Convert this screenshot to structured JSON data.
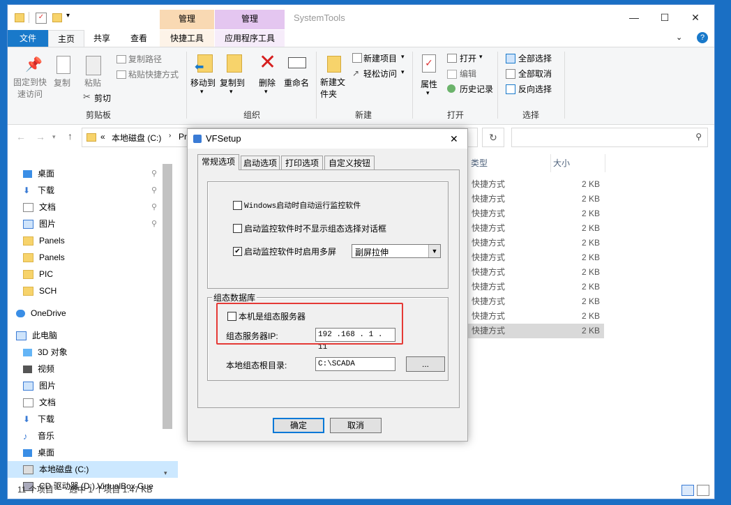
{
  "window": {
    "title": "SystemTools",
    "ctx_tabs": [
      "管理",
      "管理"
    ],
    "controls": [
      "—",
      "☐",
      "✕"
    ]
  },
  "tabs": [
    "文件",
    "主页",
    "共享",
    "查看",
    "快捷工具",
    "应用程序工具"
  ],
  "ribbon": {
    "clipboard": {
      "pin": "固定到快速访问",
      "copy": "复制",
      "paste": "粘贴",
      "copy_path": "复制路径",
      "paste_shortcut": "粘贴快捷方式",
      "cut": "剪切",
      "group": "剪贴板"
    },
    "organize": {
      "move_to": "移动到",
      "copy_to": "复制到",
      "delete": "删除",
      "rename": "重命名",
      "group": "组织"
    },
    "new": {
      "new_folder": "新建文件夹",
      "new_item": "新建项目",
      "easy_access": "轻松访问",
      "group": "新建"
    },
    "open": {
      "properties": "属性",
      "open": "打开",
      "edit": "编辑",
      "history": "历史记录",
      "group": "打开"
    },
    "select": {
      "select_all": "全部选择",
      "select_none": "全部取消",
      "invert": "反向选择",
      "group": "选择"
    }
  },
  "address": {
    "prefix": "«",
    "path": "本地磁盘 (C:)",
    "more": "Pr"
  },
  "nav_items": [
    {
      "label": "桌面",
      "icon": "desktop-icon",
      "pinned": true
    },
    {
      "label": "下载",
      "icon": "download-icon",
      "pinned": true
    },
    {
      "label": "文档",
      "icon": "document-icon",
      "pinned": true
    },
    {
      "label": "图片",
      "icon": "picture-icon",
      "pinned": true
    },
    {
      "label": "Panels",
      "icon": "folder-icon"
    },
    {
      "label": "Panels",
      "icon": "folder-icon"
    },
    {
      "label": "PIC",
      "icon": "folder-icon"
    },
    {
      "label": "SCH",
      "icon": "folder-icon"
    },
    {
      "label": "OneDrive",
      "icon": "cloud-icon"
    },
    {
      "label": "此电脑",
      "icon": "computer-icon"
    },
    {
      "label": "3D 对象",
      "icon": "cube-icon"
    },
    {
      "label": "视频",
      "icon": "video-icon"
    },
    {
      "label": "图片",
      "icon": "picture-icon"
    },
    {
      "label": "文档",
      "icon": "document-icon"
    },
    {
      "label": "下载",
      "icon": "download-icon"
    },
    {
      "label": "音乐",
      "icon": "music-icon"
    },
    {
      "label": "桌面",
      "icon": "desktop-icon"
    },
    {
      "label": "本地磁盘 (C:)",
      "icon": "drive-icon",
      "selected": true
    },
    {
      "label": "CD 驱动器 (D:) VirtualBox Gue",
      "icon": "cd-drive-icon"
    }
  ],
  "columns": {
    "type": "类型",
    "size": "大小"
  },
  "files": [
    {
      "type": "快捷方式",
      "size": "2 KB"
    },
    {
      "type": "快捷方式",
      "size": "2 KB"
    },
    {
      "type": "快捷方式",
      "size": "2 KB"
    },
    {
      "type": "快捷方式",
      "size": "2 KB"
    },
    {
      "type": "快捷方式",
      "size": "2 KB"
    },
    {
      "type": "快捷方式",
      "size": "2 KB"
    },
    {
      "type": "快捷方式",
      "size": "2 KB"
    },
    {
      "type": "快捷方式",
      "size": "2 KB"
    },
    {
      "type": "快捷方式",
      "size": "2 KB"
    },
    {
      "type": "快捷方式",
      "size": "2 KB"
    },
    {
      "type": "快捷方式",
      "size": "2 KB",
      "selected": true
    }
  ],
  "status": {
    "count": "11 个项目",
    "selection": "选中 1 个项目  1.47 KB"
  },
  "dialog": {
    "title": "VFSetup",
    "close": "✕",
    "tabs": [
      "常规选项",
      "启动选项",
      "打印选项",
      "自定义按钮"
    ],
    "opt_autostart": "Windows启动时自动运行监控软件",
    "opt_no_select": "启动监控软件时不显示组态选择对话框",
    "opt_multiscreen": "启动监控软件时启用多屏",
    "multiscreen_mode": "副屏拉伸",
    "db_group": "组态数据库",
    "is_server": "本机是组态服务器",
    "server_ip_label": "组态服务器IP:",
    "server_ip": "192 .168 . 1  . 11",
    "root_label": "本地组态根目录:",
    "root_path": "C:\\SCADA",
    "browse": "...",
    "ok": "确定",
    "cancel": "取消",
    "highlight_color": "#e53935"
  }
}
